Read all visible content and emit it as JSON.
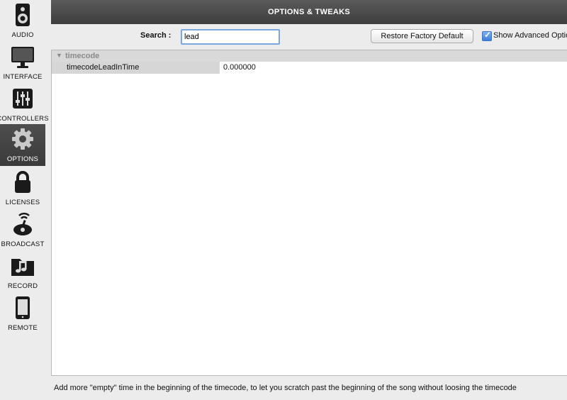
{
  "sidebar": {
    "items": [
      {
        "label": "AUDIO",
        "icon": "speaker-icon"
      },
      {
        "label": "INTERFACE",
        "icon": "monitor-icon"
      },
      {
        "label": "CONTROLLERS",
        "icon": "sliders-icon"
      },
      {
        "label": "OPTIONS",
        "icon": "gear-icon",
        "active": true
      },
      {
        "label": "LICENSES",
        "icon": "lock-icon"
      },
      {
        "label": "BROADCAST",
        "icon": "broadcast-icon"
      },
      {
        "label": "RECORD",
        "icon": "music-folder-icon"
      },
      {
        "label": "REMOTE",
        "icon": "tablet-icon"
      }
    ]
  },
  "header": {
    "title": "OPTIONS & TWEAKS"
  },
  "search": {
    "label": "Search :",
    "value": "lead"
  },
  "toolbar": {
    "restore_label": "Restore Factory Default",
    "show_advanced_label": "Show Advanced Options",
    "show_advanced_checked": true
  },
  "options": {
    "groups": [
      {
        "name": "timecode",
        "expanded": true,
        "rows": [
          {
            "name": "timecodeLeadInTime",
            "value": "0.000000"
          }
        ]
      }
    ]
  },
  "help_text": "Add more \"empty\" time in the beginning of the timecode, to let you scratch past the beginning of the song without loosing the timecode",
  "colors": {
    "accent": "#3d7fd8",
    "titlebar": "#4a4a4a",
    "active_sidebar": "#454545"
  }
}
